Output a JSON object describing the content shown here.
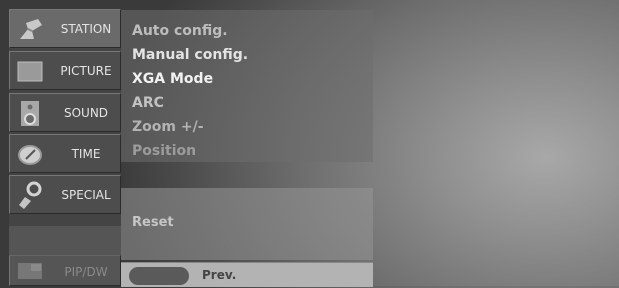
{
  "sidebar": {
    "items": [
      {
        "label": "STATION",
        "icon": "satellite-dish-icon",
        "active": true
      },
      {
        "label": "PICTURE",
        "icon": "picture-icon"
      },
      {
        "label": "SOUND",
        "icon": "speaker-icon"
      },
      {
        "label": "TIME",
        "icon": "clock-icon"
      },
      {
        "label": "SPECIAL",
        "icon": "key-tag-icon"
      },
      {
        "label": "PIP/DW",
        "icon": "pip-icon"
      }
    ]
  },
  "station_menu": {
    "items": [
      {
        "label": "Auto config."
      },
      {
        "label": "Manual config."
      },
      {
        "label": "XGA Mode"
      },
      {
        "label": "ARC"
      },
      {
        "label": "Zoom +/-"
      },
      {
        "label": "Position"
      }
    ],
    "lower_text": "Reset"
  },
  "bottom_bar": {
    "prev_label": "Prev."
  },
  "colors": {
    "menu_text_bright": "#f0f0f0",
    "menu_text_dim": "#c8c8c8",
    "menu_text_faint": "#aaaaaa"
  }
}
